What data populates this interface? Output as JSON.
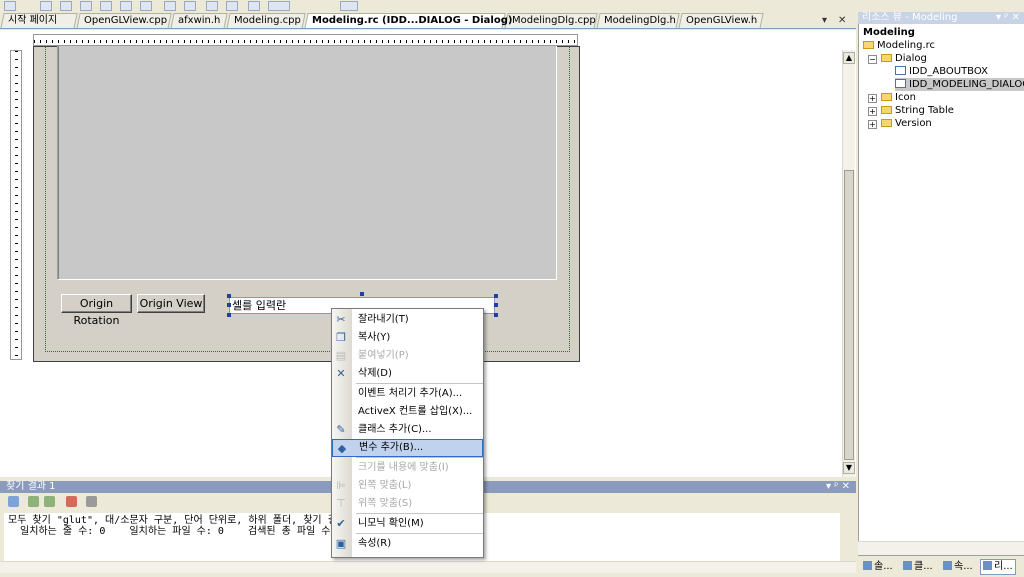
{
  "tabs": [
    {
      "label": "시작 페이지"
    },
    {
      "label": "OpenGLView.cpp"
    },
    {
      "label": "afxwin.h"
    },
    {
      "label": "Modeling.cpp"
    },
    {
      "label": "Modeling.rc (IDD...DIALOG - Dialog)",
      "active": true
    },
    {
      "label": "ModelingDlg.cpp"
    },
    {
      "label": "ModelingDlg.h"
    },
    {
      "label": "OpenGLView.h"
    }
  ],
  "tab_controls": {
    "dropdown": "▾",
    "close": "✕"
  },
  "dialog": {
    "origin_rotation_label": "Origin Rotation",
    "origin_view_label": "Origin View",
    "edit_value": "셀를 입력란"
  },
  "context_menu": {
    "items": [
      {
        "label": "잘라내기(T)",
        "icon": "scissors-icon",
        "glyph": "✂",
        "enabled": true
      },
      {
        "label": "복사(Y)",
        "icon": "copy-icon",
        "glyph": "❐",
        "enabled": true
      },
      {
        "label": "붙여넣기(P)",
        "icon": "paste-icon",
        "glyph": "▤",
        "enabled": false
      },
      {
        "label": "삭제(D)",
        "icon": "delete-icon",
        "glyph": "✕",
        "enabled": true
      },
      {
        "label": "이벤트 처리기 추가(A)...",
        "icon": "",
        "glyph": "",
        "enabled": true
      },
      {
        "label": "ActiveX 컨트롤 삽입(X)...",
        "icon": "",
        "glyph": "",
        "enabled": true
      },
      {
        "label": "클래스 추가(C)...",
        "icon": "add-class-icon",
        "glyph": "✎",
        "enabled": true
      },
      {
        "label": "변수 추가(B)...",
        "icon": "add-variable-icon",
        "glyph": "◆",
        "enabled": true,
        "highlighted": true
      },
      {
        "label": "크기를 내용에 맞춤(I)",
        "icon": "",
        "glyph": "",
        "enabled": false
      },
      {
        "label": "왼쪽 맞춤(L)",
        "icon": "align-left-icon",
        "glyph": "⊫",
        "enabled": false
      },
      {
        "label": "위쪽 맞춤(S)",
        "icon": "align-top-icon",
        "glyph": "⊤",
        "enabled": false
      },
      {
        "label": "니모닉 확인(M)",
        "icon": "check-mnemonic-icon",
        "glyph": "✔",
        "enabled": true
      },
      {
        "label": "속성(R)",
        "icon": "properties-icon",
        "glyph": "▣",
        "enabled": true
      }
    ]
  },
  "output": {
    "title": "찾기 결과 1",
    "controls": "▾ ᵖ ✕",
    "line1": "모두 찾기 \"glut\", 대/소문자 구분, 단어 단위로, 하위 폴더, 찾기 결과",
    "line2": "  일치하는 줄 수: 0    일치하는 파일 수: 0    검색된 총 파일 수: 1"
  },
  "resource_view": {
    "title": "리소스 뷰 - Modeling",
    "controls": "▾ ᵖ ✕",
    "tree": {
      "root": "Modeling",
      "rc": "Modeling.rc",
      "dialog": "Dialog",
      "aboutbox": "IDD_ABOUTBOX",
      "modeling_dialog": "IDD_MODELING_DIALOG",
      "icon": "Icon",
      "string_table": "String Table",
      "version": "Version"
    },
    "bottom_tabs": [
      "솔...",
      "클...",
      "속...",
      "리..."
    ]
  },
  "colors": {
    "menu_highlight": "#c1d2ee",
    "menu_highlight_border": "#316ac5",
    "title_bar": "#8a9bbb"
  }
}
